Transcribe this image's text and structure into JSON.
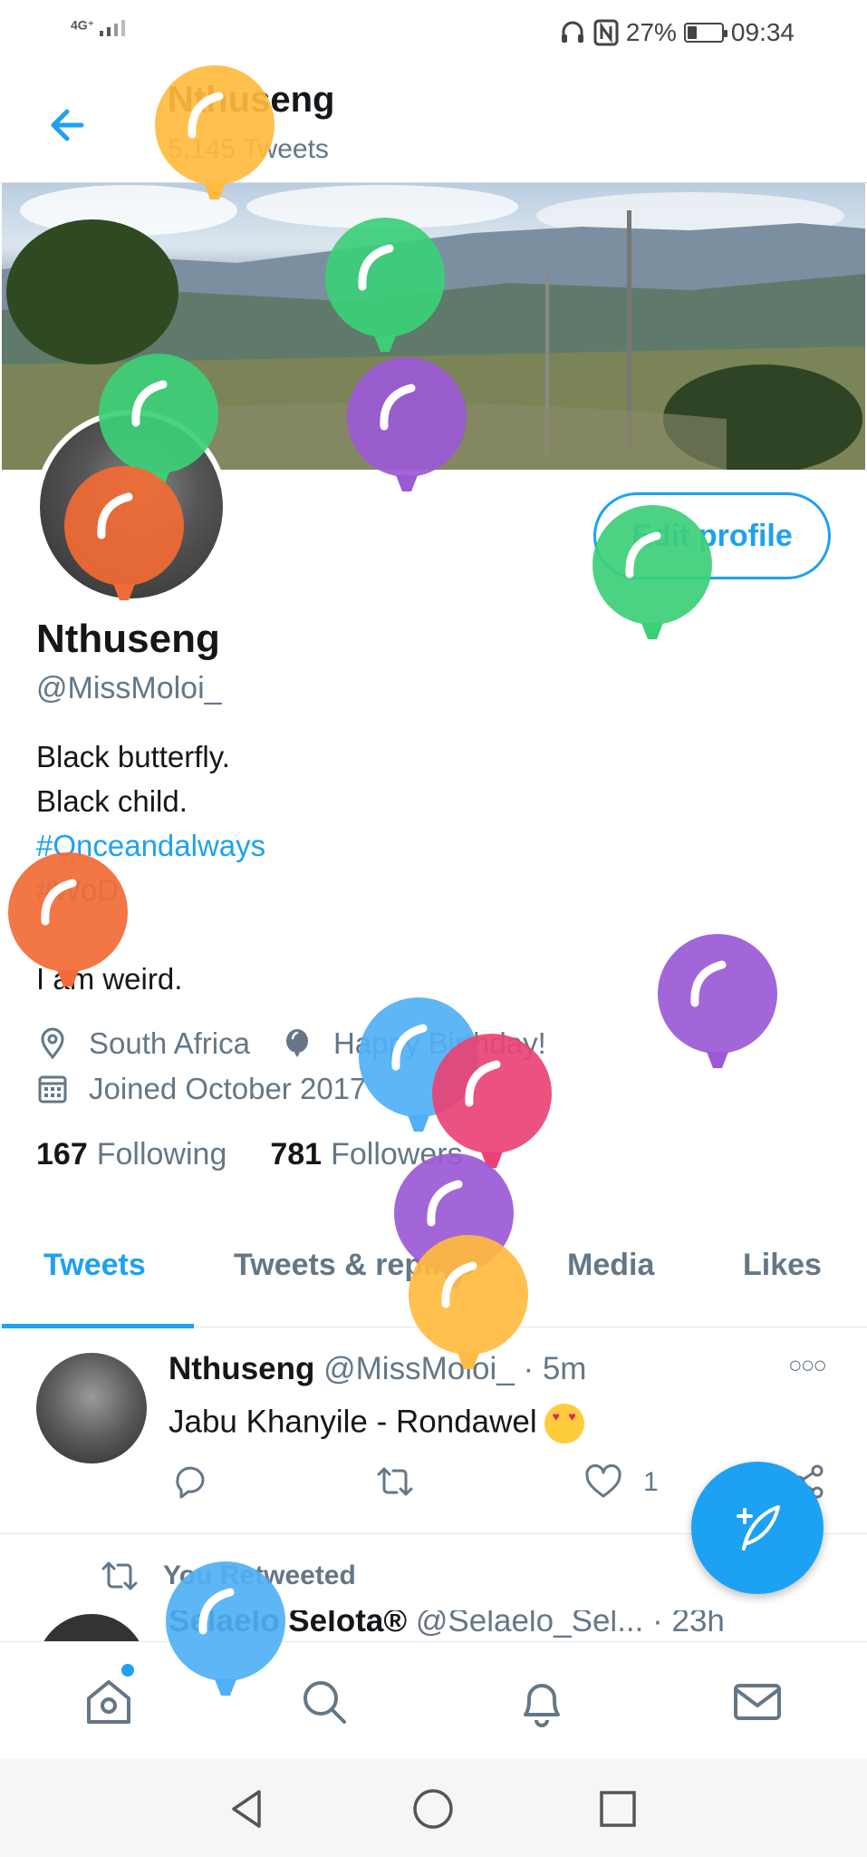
{
  "status_bar": {
    "network": "4G⁺",
    "battery_percent": "27%",
    "battery_level": 0.27,
    "time": "09:34"
  },
  "header": {
    "name": "Nthuseng",
    "tweet_count": "5,145 Tweets"
  },
  "profile": {
    "edit_button_label": "Edit profile",
    "display_name": "Nthuseng",
    "handle": "@MissMoloi_",
    "bio": {
      "line1": "Black butterfly.",
      "line2": "Black child.",
      "tag1": "#Onceandalways",
      "tag2": "#WoD",
      "line5": "I am weird."
    },
    "location": "South Africa",
    "birthday": "Happy Birthday!",
    "joined": "Joined October 2017",
    "following_count": "167",
    "following_label": "Following",
    "followers_count": "781",
    "followers_label": "Followers"
  },
  "tabs": [
    {
      "label": "Tweets",
      "active": true
    },
    {
      "label": "Tweets & replies",
      "active": false
    },
    {
      "label": "Media",
      "active": false
    },
    {
      "label": "Likes",
      "active": false
    }
  ],
  "tweets": [
    {
      "author": "Nthuseng",
      "handle": "@MissMoloi_",
      "separator": "·",
      "time": "5m",
      "text": "Jabu Khanyile - Rondawel",
      "likes": "1"
    }
  ],
  "retweet_notice": "You Retweeted",
  "tweet2": {
    "author": "Selaelo Selota®",
    "handle": "@Selaelo_Sel...",
    "separator": "·",
    "time": "23h"
  },
  "colors": {
    "accent": "#1da1f2",
    "text_primary": "#14171a",
    "text_secondary": "#657786",
    "balloons": [
      "#ffbb3f",
      "#3ccf78",
      "#9b59d6",
      "#f26a35",
      "#4fb0f5",
      "#e94374"
    ]
  },
  "icons": [
    "back-arrow-icon",
    "location-pin-icon",
    "balloon-icon",
    "calendar-icon",
    "reply-icon",
    "retweet-icon",
    "like-icon",
    "share-icon",
    "compose-tweet-icon",
    "home-icon",
    "search-icon",
    "notifications-icon",
    "messages-icon"
  ]
}
